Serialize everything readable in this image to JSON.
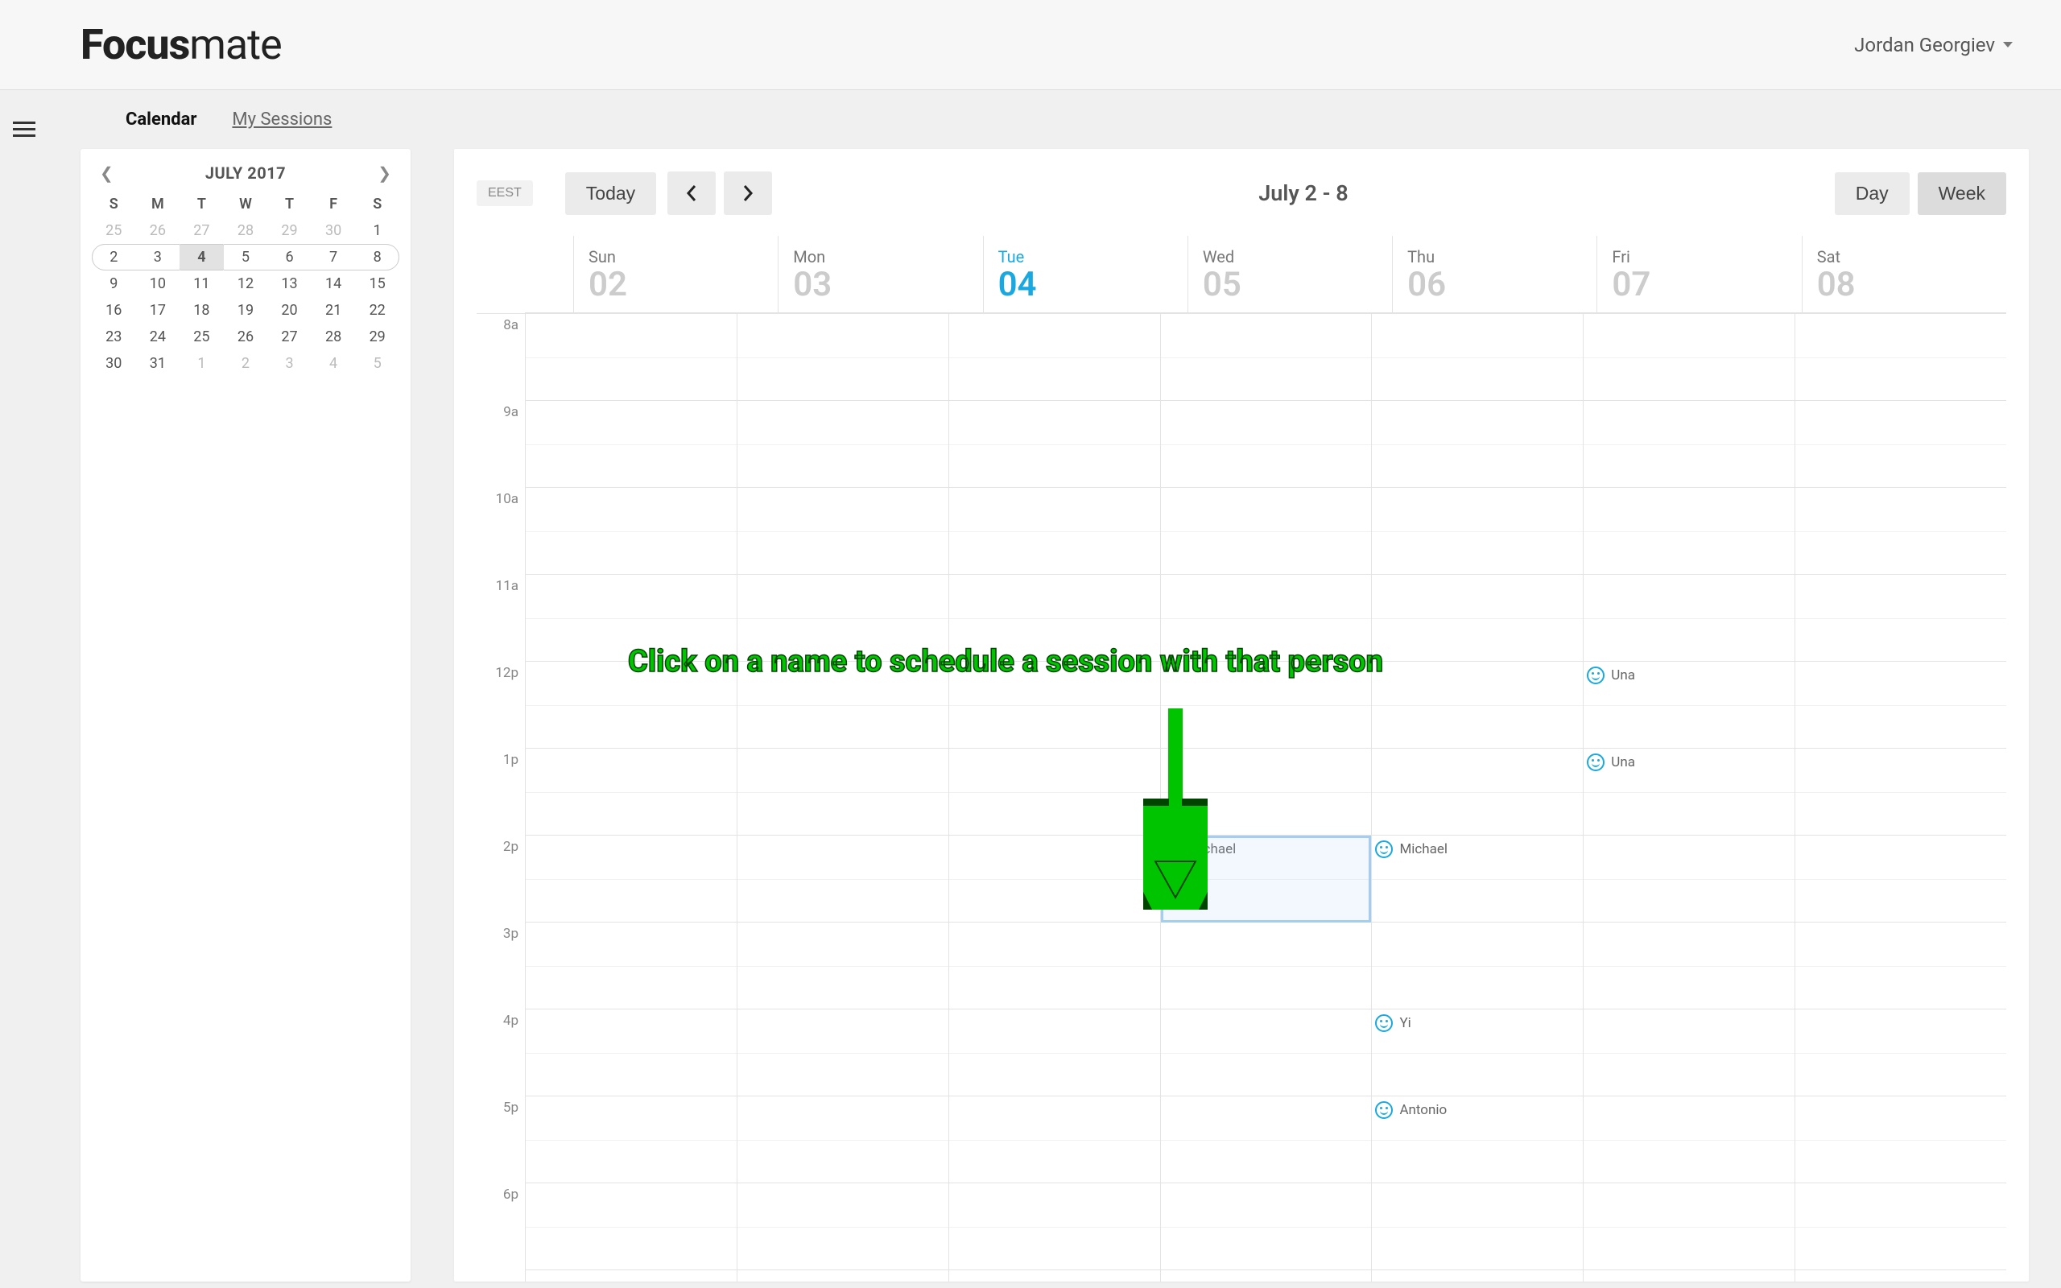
{
  "brand": {
    "bold": "Focus",
    "light": "mate"
  },
  "user": {
    "name": "Jordan Georgiev"
  },
  "tabs": {
    "calendar": "Calendar",
    "sessions": "My Sessions"
  },
  "miniCal": {
    "title": "JULY 2017",
    "dow": [
      "S",
      "M",
      "T",
      "W",
      "T",
      "F",
      "S"
    ],
    "weeks": [
      [
        {
          "n": "25",
          "o": true
        },
        {
          "n": "26",
          "o": true
        },
        {
          "n": "27",
          "o": true
        },
        {
          "n": "28",
          "o": true
        },
        {
          "n": "29",
          "o": true
        },
        {
          "n": "30",
          "o": true
        },
        {
          "n": "1"
        }
      ],
      [
        {
          "n": "2"
        },
        {
          "n": "3"
        },
        {
          "n": "4",
          "today": true
        },
        {
          "n": "5"
        },
        {
          "n": "6"
        },
        {
          "n": "7"
        },
        {
          "n": "8"
        }
      ],
      [
        {
          "n": "9"
        },
        {
          "n": "10"
        },
        {
          "n": "11"
        },
        {
          "n": "12"
        },
        {
          "n": "13"
        },
        {
          "n": "14"
        },
        {
          "n": "15"
        }
      ],
      [
        {
          "n": "16"
        },
        {
          "n": "17"
        },
        {
          "n": "18"
        },
        {
          "n": "19"
        },
        {
          "n": "20"
        },
        {
          "n": "21"
        },
        {
          "n": "22"
        }
      ],
      [
        {
          "n": "23"
        },
        {
          "n": "24"
        },
        {
          "n": "25"
        },
        {
          "n": "26"
        },
        {
          "n": "27"
        },
        {
          "n": "28"
        },
        {
          "n": "29"
        }
      ],
      [
        {
          "n": "30"
        },
        {
          "n": "31"
        },
        {
          "n": "1",
          "o": true
        },
        {
          "n": "2",
          "o": true
        },
        {
          "n": "3",
          "o": true
        },
        {
          "n": "4",
          "o": true
        },
        {
          "n": "5",
          "o": true
        }
      ]
    ],
    "currentWeekIndex": 1
  },
  "toolbar": {
    "tz": "EEST",
    "today": "Today",
    "range": "July 2 - 8",
    "day": "Day",
    "week": "Week"
  },
  "days": [
    {
      "abbr": "Sun",
      "num": "02"
    },
    {
      "abbr": "Mon",
      "num": "03"
    },
    {
      "abbr": "Tue",
      "num": "04",
      "today": true
    },
    {
      "abbr": "Wed",
      "num": "05"
    },
    {
      "abbr": "Thu",
      "num": "06"
    },
    {
      "abbr": "Fri",
      "num": "07"
    },
    {
      "abbr": "Sat",
      "num": "08"
    }
  ],
  "hours": [
    "8a",
    "9a",
    "10a",
    "11a",
    "12p",
    "1p",
    "2p",
    "3p",
    "4p",
    "5p",
    "6p"
  ],
  "events": [
    {
      "day": 5,
      "hourIdx": 4,
      "half": 0,
      "name": "Una",
      "icon": "smiley"
    },
    {
      "day": 5,
      "hourIdx": 5,
      "half": 0,
      "name": "Una",
      "icon": "smiley"
    },
    {
      "day": 3,
      "hourIdx": 6,
      "half": 0,
      "name": "Michael",
      "icon": "check",
      "highlighted": true
    },
    {
      "day": 4,
      "hourIdx": 6,
      "half": 0,
      "name": "Michael",
      "icon": "smiley"
    },
    {
      "day": 4,
      "hourIdx": 8,
      "half": 0,
      "name": "Yi",
      "icon": "smiley"
    },
    {
      "day": 4,
      "hourIdx": 9,
      "half": 0,
      "name": "Antonio",
      "icon": "smiley"
    }
  ],
  "annotation": {
    "text": "Click on a name to schedule a session with that person"
  }
}
